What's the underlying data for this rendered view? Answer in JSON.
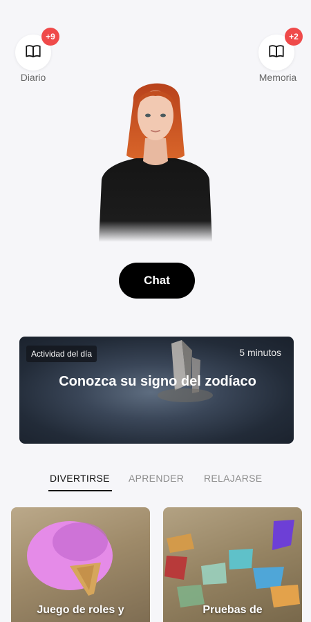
{
  "header": {
    "diary": {
      "label": "Diario",
      "badge": "+9",
      "icon": "book-icon"
    },
    "memory": {
      "label": "Memoria",
      "badge": "+2",
      "icon": "book-icon"
    }
  },
  "avatar": {
    "description_icon": "avatar-character"
  },
  "chat_button": {
    "label": "Chat"
  },
  "activity": {
    "tag": "Actividad del día",
    "duration": "5 minutos",
    "title": "Conozca su signo del zodíaco"
  },
  "tabs": [
    {
      "label": "DIVERTIRSE",
      "active": true
    },
    {
      "label": "APRENDER",
      "active": false
    },
    {
      "label": "RELAJARSE",
      "active": false
    }
  ],
  "cards": [
    {
      "title": "Juego de roles y"
    },
    {
      "title": "Pruebas de"
    }
  ],
  "colors": {
    "badge": "#ef4a4a",
    "background": "#f6f6f9",
    "chat_button": "#000000"
  }
}
